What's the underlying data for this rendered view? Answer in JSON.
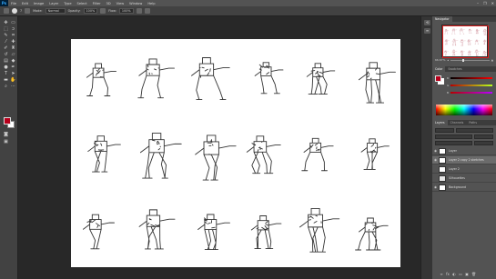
{
  "app": {
    "logo": "Ps"
  },
  "menu": [
    "File",
    "Edit",
    "Image",
    "Layer",
    "Type",
    "Select",
    "Filter",
    "3D",
    "View",
    "Window",
    "Help"
  ],
  "window_controls": [
    "–",
    "❐",
    "✕"
  ],
  "options_bar": {
    "brush_size": "7",
    "mode_label": "Mode:",
    "mode_value": "Normal",
    "opacity_label": "Opacity:",
    "opacity_value": "100%",
    "flow_label": "Flow:",
    "flow_value": "100%"
  },
  "colors": {
    "foreground": "#b8001c",
    "background": "#ffffff",
    "workspace": "#282828",
    "panel": "#535353"
  },
  "navigator": {
    "tabs": [
      "Navigator"
    ],
    "zoom": "66.67%"
  },
  "color_panel": {
    "tabs": [
      "Color",
      "Swatches"
    ],
    "channels": [
      "R",
      "G",
      "B"
    ]
  },
  "layers_panel": {
    "tabs": [
      "Layers",
      "Channels",
      "Paths"
    ],
    "layers": [
      {
        "name": "Layer",
        "visible": true,
        "selected": false
      },
      {
        "name": "Layer 2 copy 2 sketches",
        "visible": true,
        "selected": true
      },
      {
        "name": "Layer 2",
        "visible": false,
        "selected": false
      },
      {
        "name": "Silhouettes",
        "visible": false,
        "selected": false
      },
      {
        "name": "Background",
        "visible": true,
        "selected": false
      }
    ],
    "bottom_buttons": [
      "∞",
      "fx",
      "◐",
      "▭",
      "▣",
      "🗑"
    ]
  }
}
